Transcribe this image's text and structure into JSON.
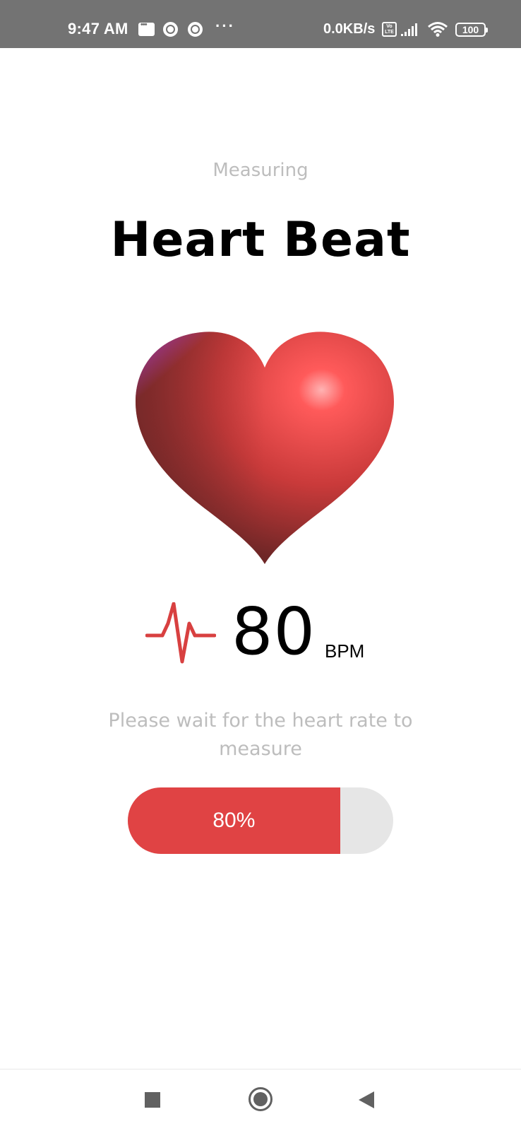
{
  "status_bar": {
    "time": "9:47 AM",
    "dots": "···",
    "network_speed": "0.0KB/s",
    "volte": "Vo LTE",
    "battery": "100",
    "icons": [
      "message-icon",
      "chrome-icon",
      "chrome-icon",
      "more-icon",
      "volte-icon",
      "signal-icon",
      "wifi-icon",
      "battery-icon"
    ]
  },
  "screen": {
    "subtitle": "Measuring",
    "title": "Heart Beat",
    "heart_image": "heart-3d-icon",
    "bpm_value": "80",
    "bpm_unit": "BPM",
    "wait_message": "Please wait for the heart rate to measure",
    "progress_label": "80%",
    "progress_value": 0.8
  },
  "colors": {
    "accent": "#e04344",
    "muted_text": "#bdbdbd",
    "track": "#e6e6e6",
    "status_bar_bg": "#737373"
  },
  "nav_bar": {
    "buttons": [
      "recents-square-icon",
      "home-circle-icon",
      "back-triangle-icon"
    ]
  }
}
